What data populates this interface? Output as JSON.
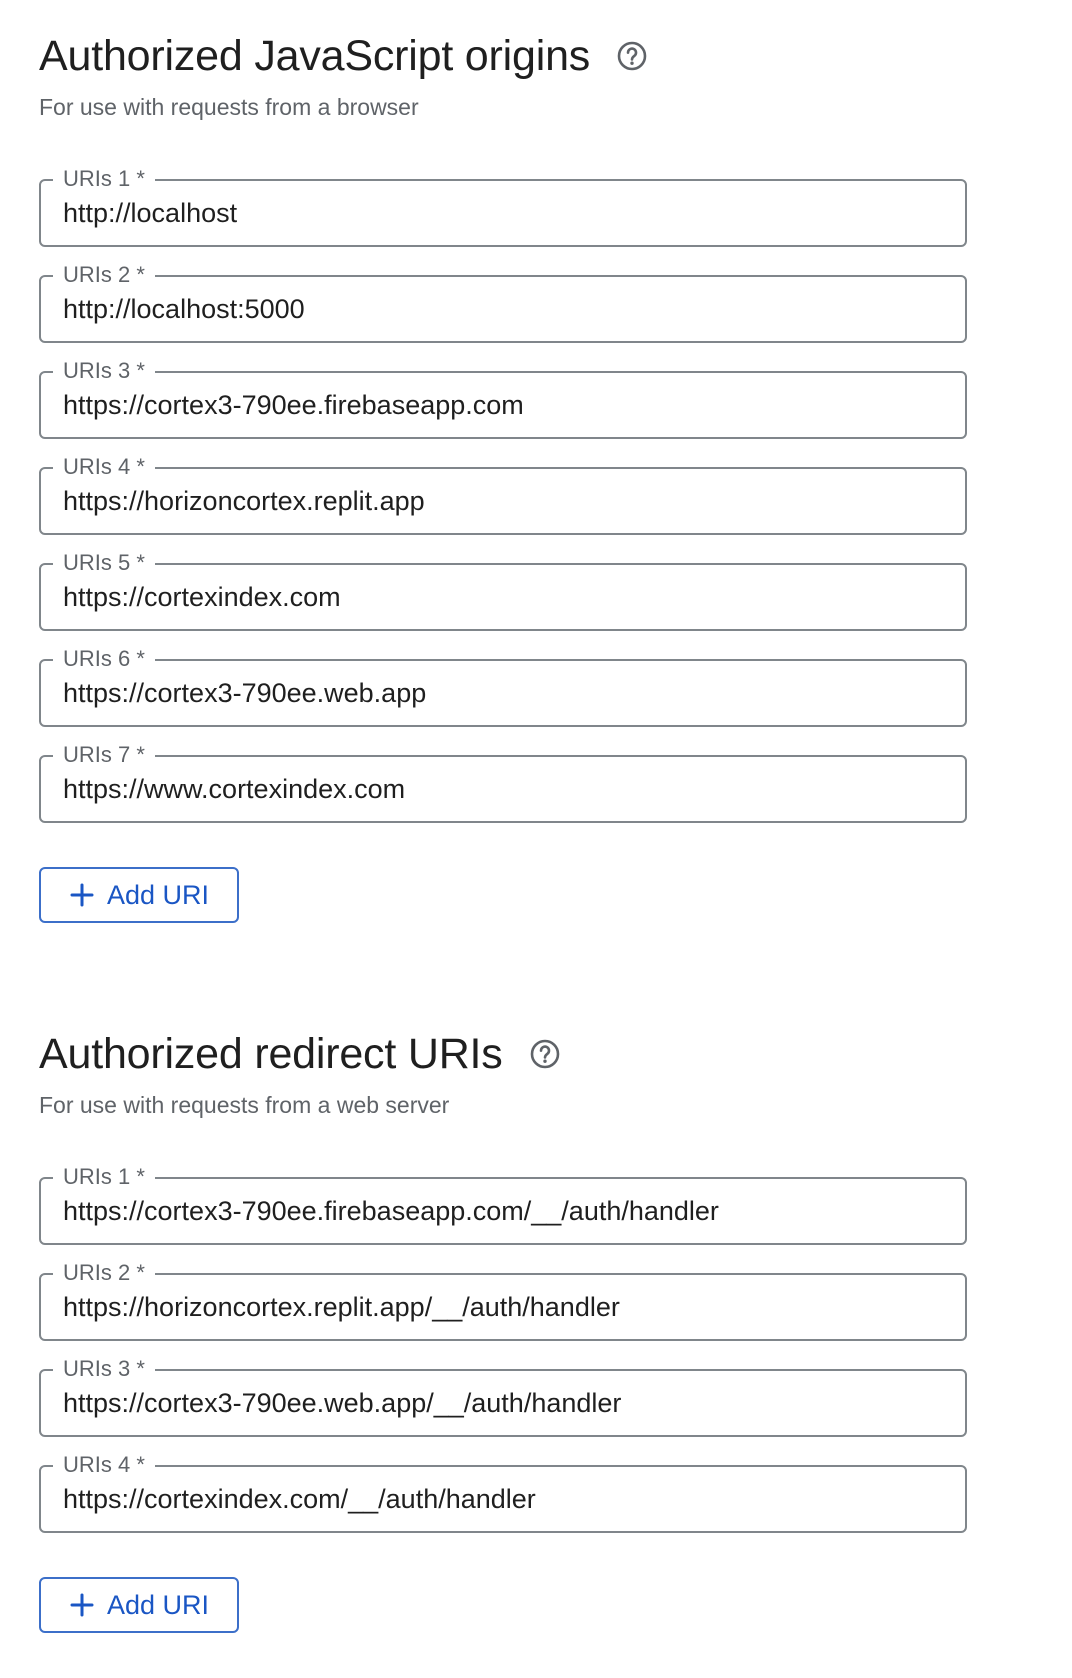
{
  "origins": {
    "title": "Authorized JavaScript origins",
    "subtitle": "For use with requests from a browser",
    "fields": [
      {
        "label": "URIs 1 *",
        "value": "http://localhost"
      },
      {
        "label": "URIs 2 *",
        "value": "http://localhost:5000"
      },
      {
        "label": "URIs 3 *",
        "value": "https://cortex3-790ee.firebaseapp.com"
      },
      {
        "label": "URIs 4 *",
        "value": "https://horizoncortex.replit.app"
      },
      {
        "label": "URIs 5 *",
        "value": "https://cortexindex.com"
      },
      {
        "label": "URIs 6 *",
        "value": "https://cortex3-790ee.web.app"
      },
      {
        "label": "URIs 7 *",
        "value": "https://www.cortexindex.com"
      }
    ],
    "add_label": "Add URI"
  },
  "redirects": {
    "title": "Authorized redirect URIs",
    "subtitle": "For use with requests from a web server",
    "fields": [
      {
        "label": "URIs 1 *",
        "value": "https://cortex3-790ee.firebaseapp.com/__/auth/handler"
      },
      {
        "label": "URIs 2 *",
        "value": "https://horizoncortex.replit.app/__/auth/handler"
      },
      {
        "label": "URIs 3 *",
        "value": "https://cortex3-790ee.web.app/__/auth/handler"
      },
      {
        "label": "URIs 4 *",
        "value": "https://cortexindex.com/__/auth/handler"
      }
    ],
    "add_label": "Add URI"
  },
  "icons": {
    "help": "help-circle-icon",
    "add": "plus-icon"
  },
  "colors": {
    "accent": "#1a56c4",
    "border": "#80868b",
    "subtle_text": "#5f6368"
  }
}
